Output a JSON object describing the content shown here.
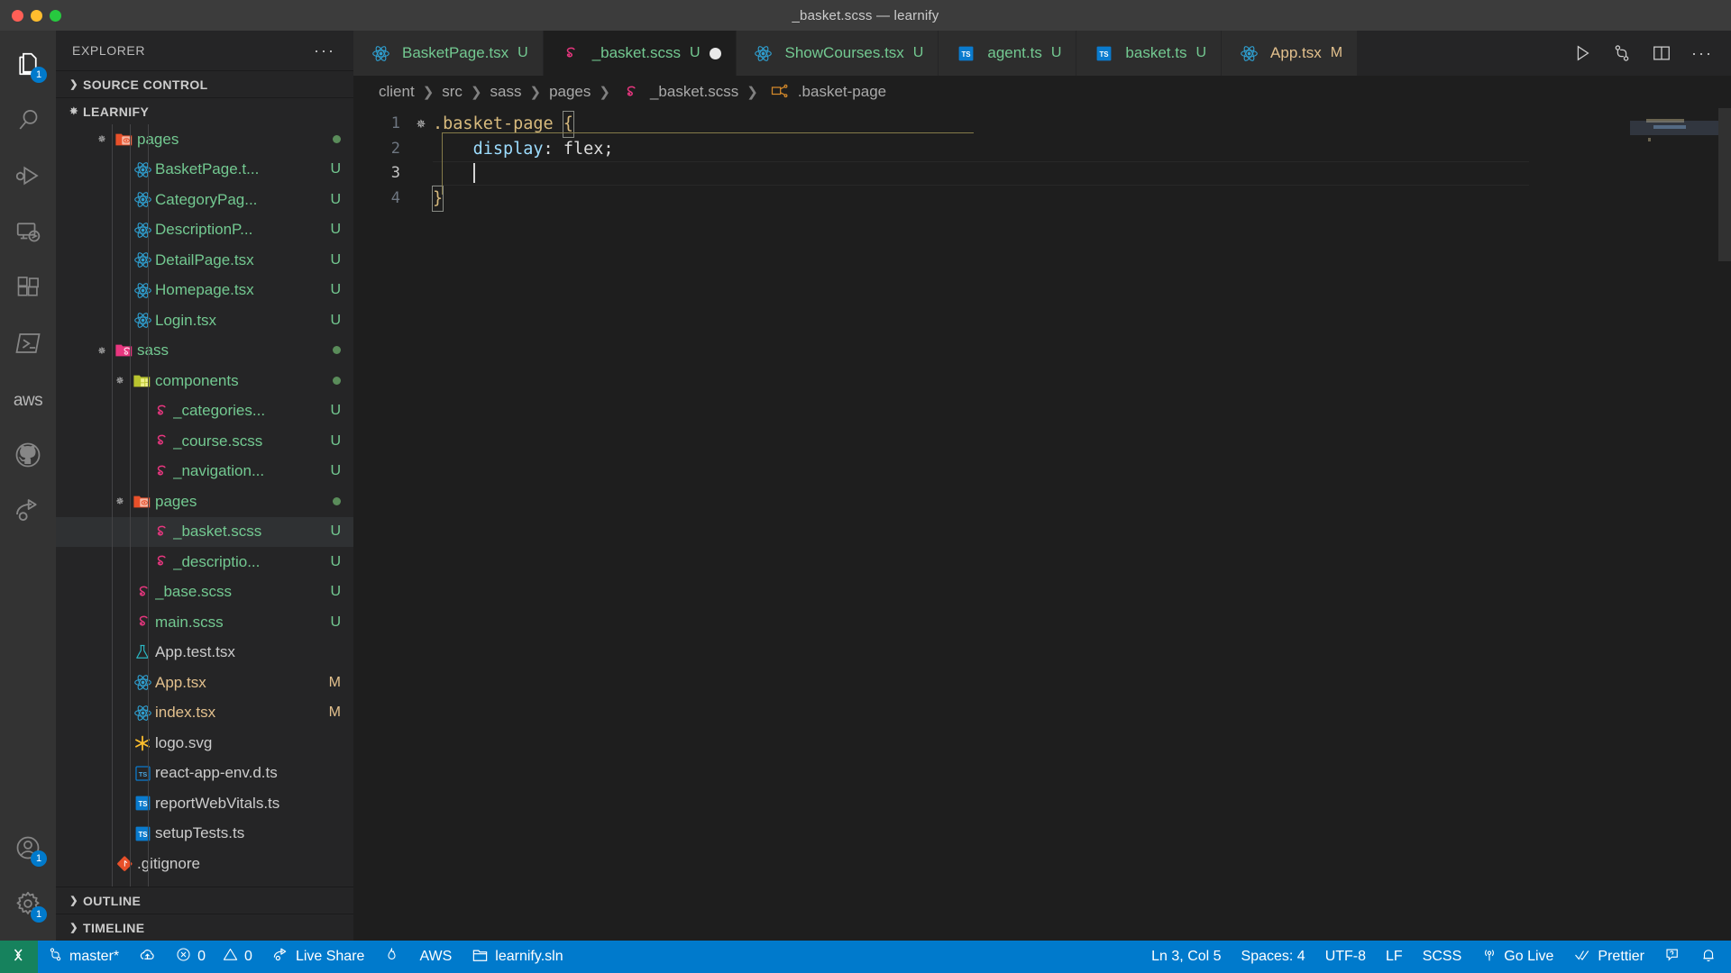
{
  "window": {
    "title": "_basket.scss — learnify",
    "traffic_lights": [
      "close",
      "minimize",
      "maximize"
    ]
  },
  "activitybar": {
    "items": [
      {
        "name": "explorer",
        "icon": "files-icon",
        "badge": "1",
        "active": true
      },
      {
        "name": "search",
        "icon": "search-icon",
        "badge": "",
        "active": false
      },
      {
        "name": "run-debug",
        "icon": "run-debug-icon",
        "badge": "",
        "active": false
      },
      {
        "name": "remote",
        "icon": "remote-explorer-icon",
        "badge": "",
        "active": false
      },
      {
        "name": "extensions",
        "icon": "extensions-icon",
        "badge": "",
        "active": false
      },
      {
        "name": "powershell",
        "icon": "terminal-icon",
        "badge": "",
        "active": false
      },
      {
        "name": "aws",
        "icon": "aws-icon",
        "badge": "",
        "active": false,
        "label": "aws"
      },
      {
        "name": "github",
        "icon": "github-icon",
        "badge": "",
        "active": false
      },
      {
        "name": "live-share",
        "icon": "live-share-icon",
        "badge": "",
        "active": false
      }
    ],
    "bottom_items": [
      {
        "name": "accounts",
        "icon": "account-icon",
        "badge": "1"
      },
      {
        "name": "settings",
        "icon": "gear-icon",
        "badge": "1"
      }
    ]
  },
  "sidebar": {
    "header": {
      "title": "EXPLORER",
      "more_actions": "···"
    },
    "sections": [
      {
        "label": "SOURCE CONTROL",
        "expanded": false
      },
      {
        "label": "LEARNIFY",
        "expanded": true
      },
      {
        "label": "OUTLINE",
        "expanded": false
      },
      {
        "label": "TIMELINE",
        "expanded": false
      }
    ],
    "tree": [
      {
        "label": "pages",
        "icon": "folder-pages-icon",
        "kind": "folder",
        "indent": 2,
        "expanded": true,
        "status": "dot",
        "color": "green",
        "selected": false
      },
      {
        "label": "BasketPage.t...",
        "icon": "react-icon",
        "kind": "file",
        "indent": 3,
        "status": "U",
        "color": "green",
        "selected": false
      },
      {
        "label": "CategoryPag...",
        "icon": "react-icon",
        "kind": "file",
        "indent": 3,
        "status": "U",
        "color": "green",
        "selected": false
      },
      {
        "label": "DescriptionP...",
        "icon": "react-icon",
        "kind": "file",
        "indent": 3,
        "status": "U",
        "color": "green",
        "selected": false
      },
      {
        "label": "DetailPage.tsx",
        "icon": "react-icon",
        "kind": "file",
        "indent": 3,
        "status": "U",
        "color": "green",
        "selected": false
      },
      {
        "label": "Homepage.tsx",
        "icon": "react-icon",
        "kind": "file",
        "indent": 3,
        "status": "U",
        "color": "green",
        "selected": false
      },
      {
        "label": "Login.tsx",
        "icon": "react-icon",
        "kind": "file",
        "indent": 3,
        "status": "U",
        "color": "green",
        "selected": false
      },
      {
        "label": "sass",
        "icon": "folder-sass-icon",
        "kind": "folder",
        "indent": 2,
        "expanded": true,
        "status": "dot",
        "color": "green",
        "selected": false
      },
      {
        "label": "components",
        "icon": "folder-components-icon",
        "kind": "folder",
        "indent": 3,
        "expanded": true,
        "status": "dot",
        "color": "green",
        "selected": false
      },
      {
        "label": "_categories...",
        "icon": "sass-icon",
        "kind": "file",
        "indent": 4,
        "status": "U",
        "color": "green",
        "selected": false
      },
      {
        "label": "_course.scss",
        "icon": "sass-icon",
        "kind": "file",
        "indent": 4,
        "status": "U",
        "color": "green",
        "selected": false
      },
      {
        "label": "_navigation...",
        "icon": "sass-icon",
        "kind": "file",
        "indent": 4,
        "status": "U",
        "color": "green",
        "selected": false
      },
      {
        "label": "pages",
        "icon": "folder-pages-icon",
        "kind": "folder",
        "indent": 3,
        "expanded": true,
        "status": "dot",
        "color": "green",
        "selected": false
      },
      {
        "label": "_basket.scss",
        "icon": "sass-icon",
        "kind": "file",
        "indent": 4,
        "status": "U",
        "color": "green",
        "selected": true
      },
      {
        "label": "_descriptio...",
        "icon": "sass-icon",
        "kind": "file",
        "indent": 4,
        "status": "U",
        "color": "green",
        "selected": false
      },
      {
        "label": "_base.scss",
        "icon": "sass-icon",
        "kind": "file",
        "indent": 3,
        "status": "U",
        "color": "green",
        "selected": false
      },
      {
        "label": "main.scss",
        "icon": "sass-icon",
        "kind": "file",
        "indent": 3,
        "status": "U",
        "color": "green",
        "selected": false
      },
      {
        "label": "App.test.tsx",
        "icon": "test-flask-icon",
        "kind": "file",
        "indent": 3,
        "status": "",
        "color": "white",
        "selected": false
      },
      {
        "label": "App.tsx",
        "icon": "react-icon",
        "kind": "file",
        "indent": 3,
        "status": "M",
        "color": "orange",
        "selected": false
      },
      {
        "label": "index.tsx",
        "icon": "react-icon",
        "kind": "file",
        "indent": 3,
        "status": "M",
        "color": "orange",
        "selected": false
      },
      {
        "label": "logo.svg",
        "icon": "svg-icon",
        "kind": "file",
        "indent": 3,
        "status": "",
        "color": "white",
        "selected": false
      },
      {
        "label": "react-app-env.d.ts",
        "icon": "ts-def-icon",
        "kind": "file",
        "indent": 3,
        "status": "",
        "color": "white",
        "selected": false
      },
      {
        "label": "reportWebVitals.ts",
        "icon": "ts-icon",
        "kind": "file",
        "indent": 3,
        "status": "",
        "color": "white",
        "selected": false
      },
      {
        "label": "setupTests.ts",
        "icon": "ts-icon",
        "kind": "file",
        "indent": 3,
        "status": "",
        "color": "white",
        "selected": false
      },
      {
        "label": ".gitignore",
        "icon": "git-icon",
        "kind": "file",
        "indent": 2,
        "status": "",
        "color": "white",
        "selected": false
      }
    ]
  },
  "tabs": [
    {
      "label": "BasketPage.tsx",
      "icon": "react-icon",
      "status": "U",
      "active": false,
      "dirty": false
    },
    {
      "label": "_basket.scss",
      "icon": "sass-icon",
      "status": "U",
      "active": true,
      "dirty": true
    },
    {
      "label": "ShowCourses.tsx",
      "icon": "react-icon",
      "status": "U",
      "active": false,
      "dirty": false
    },
    {
      "label": "agent.ts",
      "icon": "ts-icon",
      "status": "U",
      "active": false,
      "dirty": false
    },
    {
      "label": "basket.ts",
      "icon": "ts-icon",
      "status": "U",
      "active": false,
      "dirty": false
    },
    {
      "label": "App.tsx",
      "icon": "react-icon",
      "status": "M",
      "active": false,
      "dirty": false
    }
  ],
  "editor_actions": [
    {
      "name": "run-file",
      "icon": "play-icon"
    },
    {
      "name": "split-compare",
      "icon": "source-control-icon"
    },
    {
      "name": "split-editor",
      "icon": "split-editor-icon"
    },
    {
      "name": "more-actions",
      "icon": "more-icon",
      "label": "···"
    }
  ],
  "breadcrumbs": [
    {
      "label": "client",
      "icon": ""
    },
    {
      "label": "src",
      "icon": ""
    },
    {
      "label": "sass",
      "icon": ""
    },
    {
      "label": "pages",
      "icon": ""
    },
    {
      "label": "_basket.scss",
      "icon": "sass-icon"
    },
    {
      "label": ".basket-page",
      "icon": "css-selector-icon"
    }
  ],
  "editor": {
    "language": "SCSS",
    "lines": [
      {
        "number": "1",
        "foldable": true,
        "text": ".basket-page {"
      },
      {
        "number": "2",
        "foldable": false,
        "text": "    display: flex;"
      },
      {
        "number": "3",
        "foldable": false,
        "text": "    "
      },
      {
        "number": "4",
        "foldable": false,
        "text": "}"
      }
    ],
    "tokens": {
      "selector": ".basket-page",
      "open_brace": "{",
      "property": "display",
      "colon": ":",
      "value": "flex",
      "semicolon": ";",
      "close_brace": "}"
    },
    "colors": {
      "selector": "#d7ba7d",
      "property": "#9cdcfe",
      "value": "#dcdcdc",
      "background": "#1e1e1e"
    },
    "cursor_line": 3
  },
  "statusbar": {
    "left": [
      {
        "name": "remote-host",
        "icon": "remote-icon",
        "label": ""
      },
      {
        "name": "branch",
        "icon": "source-control-icon",
        "label": "master*"
      },
      {
        "name": "sync-changes",
        "icon": "cloud-upload-icon",
        "label": ""
      },
      {
        "name": "errors",
        "icon": "error-icon",
        "label": "0"
      },
      {
        "name": "warnings",
        "icon": "warning-icon",
        "label": "0"
      },
      {
        "name": "live-share",
        "icon": "live-share-icon",
        "label": "Live Share"
      },
      {
        "name": "flame",
        "icon": "flame-icon",
        "label": ""
      },
      {
        "name": "aws",
        "icon": "",
        "label": "AWS"
      },
      {
        "name": "solution",
        "icon": "folder-icon",
        "label": "learnify.sln"
      }
    ],
    "right": [
      {
        "name": "cursor-position",
        "icon": "",
        "label": "Ln 3, Col 5"
      },
      {
        "name": "indentation",
        "icon": "",
        "label": "Spaces: 4"
      },
      {
        "name": "encoding",
        "icon": "",
        "label": "UTF-8"
      },
      {
        "name": "eol",
        "icon": "",
        "label": "LF"
      },
      {
        "name": "language-mode",
        "icon": "",
        "label": "SCSS"
      },
      {
        "name": "go-live",
        "icon": "broadcast-icon",
        "label": "Go Live"
      },
      {
        "name": "prettier",
        "icon": "checkmarks-icon",
        "label": "Prettier"
      },
      {
        "name": "feedback",
        "icon": "feedback-icon",
        "label": ""
      },
      {
        "name": "notifications",
        "icon": "bell-icon",
        "label": ""
      }
    ],
    "colors": {
      "background": "#007acc",
      "remote_background": "#16825d"
    }
  }
}
